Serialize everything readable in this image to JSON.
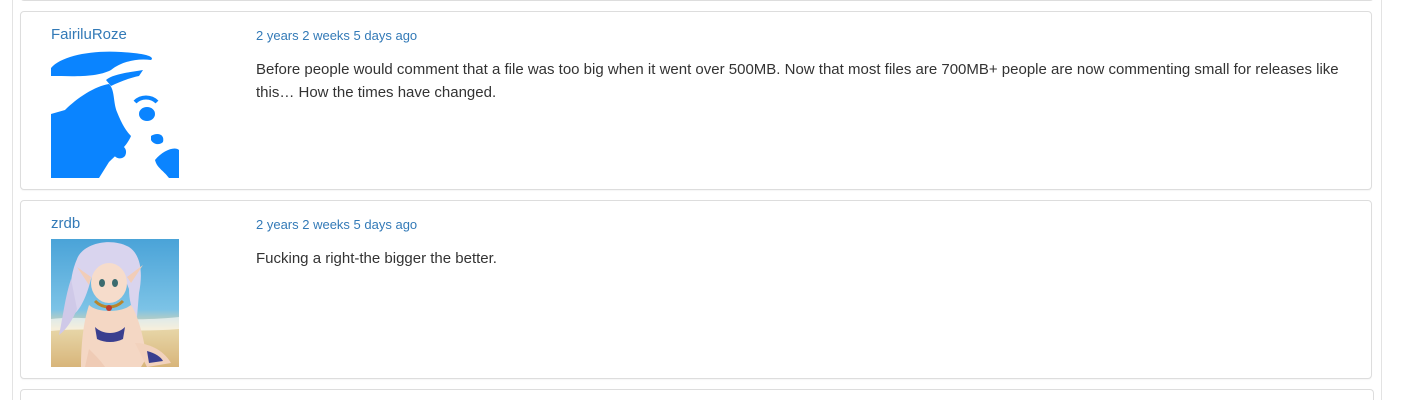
{
  "comments": [
    {
      "username": "FairiluRoze",
      "time_ago": "2 years 2 weeks 5 days ago",
      "text": "Before people would comment that a file was too big when it went over 500MB. Now that most files are 700MB+ people are now commenting small for releases like this… How the times have changed."
    },
    {
      "username": "zrdb",
      "time_ago": "2 years 2 weeks 5 days ago",
      "text": "Fucking a right-the bigger the better."
    }
  ],
  "colors": {
    "link": "#337ab7",
    "text": "#333333",
    "border": "#dddddd",
    "avatar_silhouette": "#0a84ff"
  }
}
